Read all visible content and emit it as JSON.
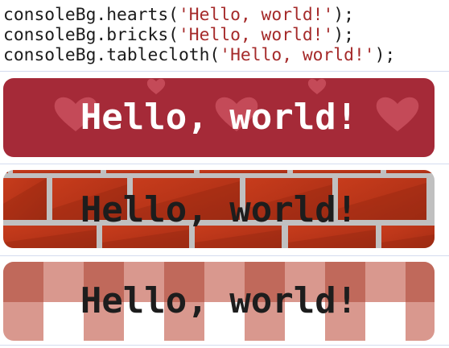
{
  "console": {
    "lines": [
      {
        "prefix": "consoleBg.hearts(",
        "string": "'Hello, world!'",
        "suffix": ");"
      },
      {
        "prefix": "consoleBg.bricks(",
        "string": "'Hello, world!'",
        "suffix": ");"
      },
      {
        "prefix": "consoleBg.tablecloth(",
        "string": "'Hello, world!'",
        "suffix": ");"
      }
    ]
  },
  "banners": {
    "hearts": {
      "text": "Hello, world!",
      "background": "#a52a38",
      "pattern_color": "#d05060",
      "text_color": "#ffffff"
    },
    "bricks": {
      "text": "Hello, world!",
      "brick_color": "#c0391a",
      "mortar_color": "#c0c0c0",
      "text_color": "#1d1d1d"
    },
    "tablecloth": {
      "text": "Hello, world!",
      "dark_color": "#c0695b",
      "light_color": "#d9988e",
      "text_color": "#1d1d1d"
    }
  }
}
